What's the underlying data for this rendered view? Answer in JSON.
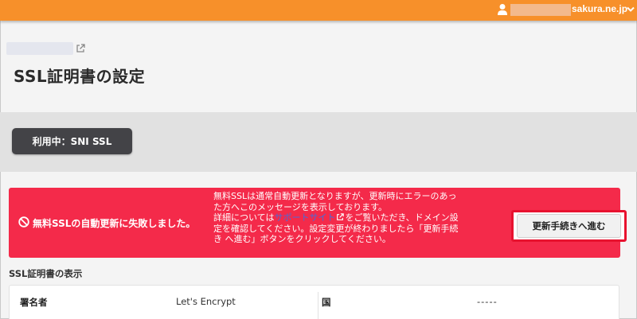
{
  "topbar": {
    "account_domain": "sakura.ne.jp",
    "color": "#f7902a"
  },
  "header": {
    "title": "SSL証明書の設定"
  },
  "status": {
    "label": "利用中：SNI SSL"
  },
  "alert": {
    "title": "無料SSLの自動更新に失敗しました。",
    "message_line1": "無料SSLは通常自動更新となりますが、更新時にエラーのあっ",
    "message_line2": "た方へこのメッセージを表示しております。",
    "message_line3_pre": "詳細については",
    "support_link": "サポートサイト",
    "message_line3_post": "をご覧いただき、ドメイン設",
    "message_line4": "定を確認してください。設定変更が終わりましたら「更新手続",
    "message_line5": "き へ進む」ボタンをクリックしてください。",
    "renew_button": "更新手続きへ進む",
    "color": "#f42a4a"
  },
  "cert": {
    "section_label": "SSL証明書の表示",
    "signer_label": "署名者",
    "signer_value": "Let's Encrypt",
    "country_label": "国",
    "country_value": "-----"
  }
}
